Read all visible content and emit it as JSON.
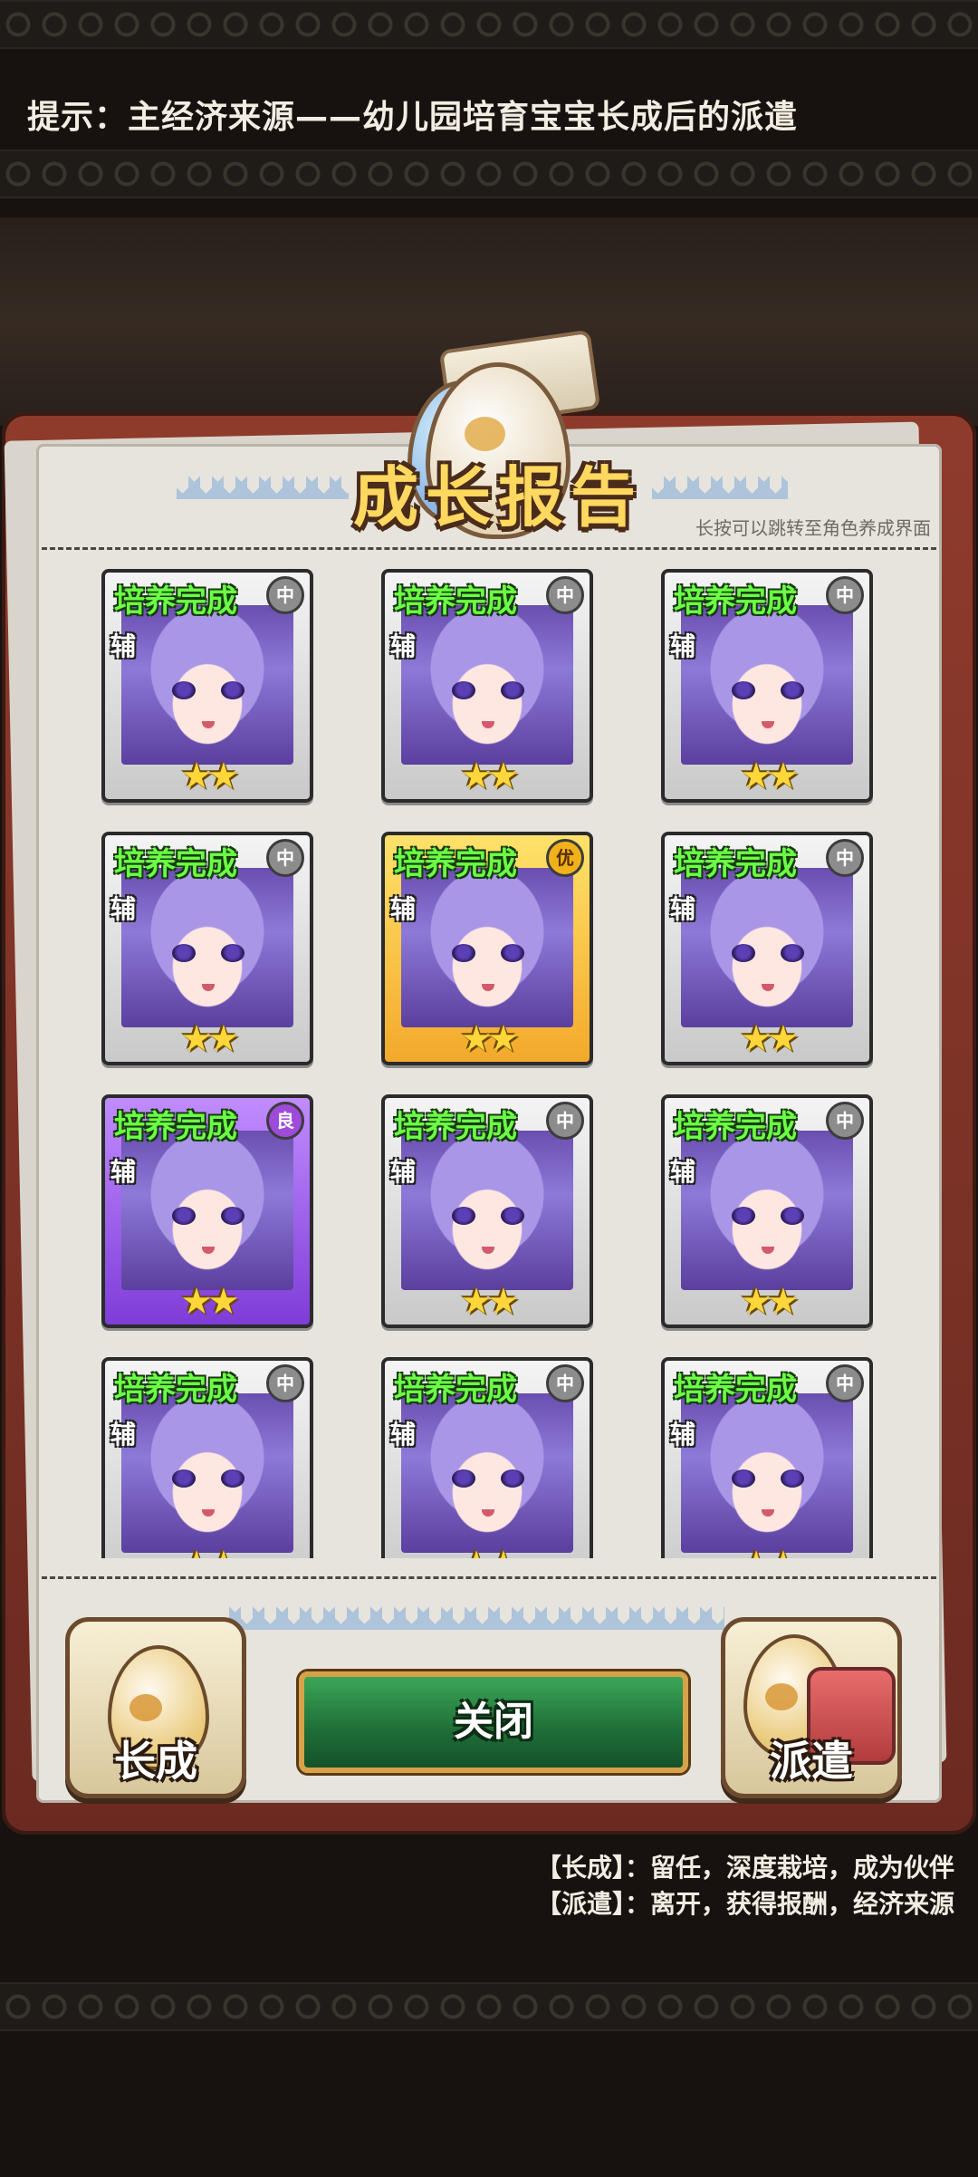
{
  "hint": "提示：主经济来源——幼儿园培育宝宝长成后的派遣",
  "title": "成长报告",
  "subtitle": "长按可以跳转至角色养成界面",
  "cards": [
    {
      "status": "培养完成",
      "quality": "中",
      "role": "辅",
      "stars": "★★",
      "tier": "normal"
    },
    {
      "status": "培养完成",
      "quality": "中",
      "role": "辅",
      "stars": "★★",
      "tier": "normal"
    },
    {
      "status": "培养完成",
      "quality": "中",
      "role": "辅",
      "stars": "★★",
      "tier": "normal"
    },
    {
      "status": "培养完成",
      "quality": "中",
      "role": "辅",
      "stars": "★★",
      "tier": "normal"
    },
    {
      "status": "培养完成",
      "quality": "优",
      "role": "辅",
      "stars": "★★",
      "tier": "gold"
    },
    {
      "status": "培养完成",
      "quality": "中",
      "role": "辅",
      "stars": "★★",
      "tier": "normal"
    },
    {
      "status": "培养完成",
      "quality": "良",
      "role": "辅",
      "stars": "★★",
      "tier": "purple"
    },
    {
      "status": "培养完成",
      "quality": "中",
      "role": "辅",
      "stars": "★★",
      "tier": "normal"
    },
    {
      "status": "培养完成",
      "quality": "中",
      "role": "辅",
      "stars": "★★",
      "tier": "normal"
    },
    {
      "status": "培养完成",
      "quality": "中",
      "role": "辅",
      "stars": "★★",
      "tier": "normal"
    },
    {
      "status": "培养完成",
      "quality": "中",
      "role": "辅",
      "stars": "★★",
      "tier": "normal"
    },
    {
      "status": "培养完成",
      "quality": "中",
      "role": "辅",
      "stars": "★★",
      "tier": "normal"
    }
  ],
  "buttons": {
    "grow": "长成",
    "close": "关闭",
    "dispatch": "派遣"
  },
  "legend": {
    "line1": "【长成】：留任，深度栽培，成为伙伴",
    "line2": "【派遣】：离开，获得报酬，经济来源"
  }
}
